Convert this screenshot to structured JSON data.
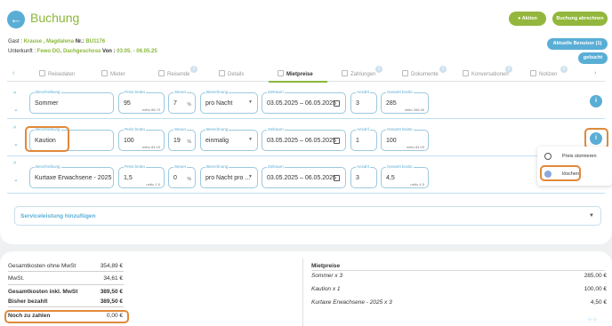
{
  "header": {
    "title": "Buchung",
    "aktion_label": "Aktion",
    "abrechnen_label": "Buchung abrechnen",
    "aktueller_benutzer_label": "Aktuelle Benutzer (1)",
    "gebucht_label": "gebucht"
  },
  "guest": {
    "gast_label": "Gast :",
    "gast_name": "Krause , Magdalena",
    "nr_label": "Nr.:",
    "nr_value": "BU1176",
    "unterkunft_label": "Unterkunft :",
    "unterkunft_value": "Fewo DG, Dachgeschoss",
    "von_label": "Von :",
    "von_value": "03.05. - 06.05.25"
  },
  "tabs": [
    {
      "label": "Reisedaten",
      "badge": ""
    },
    {
      "label": "Mieter",
      "badge": ""
    },
    {
      "label": "Reisende",
      "badge": "3"
    },
    {
      "label": "Details",
      "badge": ""
    },
    {
      "label": "Mietpreise",
      "badge": ""
    },
    {
      "label": "Zahlungen",
      "badge": "1"
    },
    {
      "label": "Dokumente",
      "badge": "1"
    },
    {
      "label": "Konversationen",
      "badge": "5"
    },
    {
      "label": "Notizen",
      "badge": "0"
    }
  ],
  "labels": {
    "beschreibung": "Beschreibung",
    "preis": "Preis brutto",
    "steuer": "Steuer",
    "berechnung": "Berechnung",
    "zeitraum": "Zeitraum",
    "anzahl": "Anzahl",
    "gesamt": "Gesamt brutto"
  },
  "price_rows": [
    {
      "beschreibung": "Sommer",
      "preis": "95",
      "preis_netto": "netto 88.79",
      "steuer": "7",
      "steuer_unit": "%",
      "berechnung": "pro Nacht",
      "zeitraum": "03.05.2025 – 06.05.2025",
      "anzahl": "3",
      "gesamt": "285",
      "gesamt_netto": "netto 266.36"
    },
    {
      "beschreibung": "Kaution",
      "preis": "100",
      "preis_netto": "netto 84.03",
      "steuer": "19",
      "steuer_unit": "%",
      "berechnung": "einmalig",
      "zeitraum": "03.05.2025 – 06.05.2025",
      "anzahl": "1",
      "gesamt": "100",
      "gesamt_netto": "netto 84.03"
    },
    {
      "beschreibung": "Kurtaxe Erwachsene - 2025",
      "preis": "1,5",
      "preis_netto": "netto 1.5",
      "steuer": "0",
      "steuer_unit": "%",
      "berechnung": "pro Nacht pro ...",
      "zeitraum": "03.05.2025 – 06.05.2025",
      "anzahl": "3",
      "gesamt": "4,5",
      "gesamt_netto": "netto 4.5"
    }
  ],
  "context_menu": {
    "storno_label": "Preis stornieren",
    "loeschen_label": "löschen"
  },
  "service": {
    "label": "Serviceleistung hinzufügen"
  },
  "totals": {
    "ohne_mwst_label": "Gesamtkosten ohne MwSt",
    "ohne_mwst_value": "354,89 €",
    "mwst_label": "MwSt.",
    "mwst_value": "34,61 €",
    "inkl_mwst_label": "Gesamtkosten inkl. MwSt",
    "inkl_mwst_value": "389,50 €",
    "bezahlt_label": "Bisher bezahlt",
    "bezahlt_value": "389,50 €",
    "noch_label": "Noch zu zahlen",
    "noch_value": "0,00 €"
  },
  "mietpreise": {
    "title": "Mietpreise",
    "items": [
      {
        "label": "Sommer x 3",
        "value": "285,00 €"
      },
      {
        "label": "Kaution x 1",
        "value": "100,00 €"
      },
      {
        "label": "Kurtaxe Erwachsene - 2025 x 3",
        "value": "4,50 €"
      }
    ]
  },
  "colors": {
    "accent_green": "#8ab83a",
    "accent_blue": "#5aaed6",
    "highlight_orange": "#e0893a"
  }
}
